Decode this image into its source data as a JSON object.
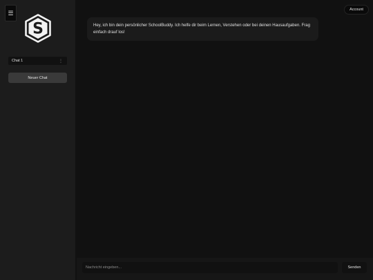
{
  "sidebar": {
    "menu_icon": "hamburger-icon",
    "menu_glyph": "☰",
    "logo_icon": "schoolbuddy-hexagon-logo",
    "logo_letter": "S",
    "chats": [
      {
        "label": "Chat 1",
        "options_glyph": "⋮"
      }
    ],
    "new_chat_label": "Neuer Chat"
  },
  "header": {
    "account_label": "Account"
  },
  "messages": [
    {
      "role": "bot",
      "text": "Hey, ich bin dein persönlicher SchoolBuddy. Ich helfe dir beim Lernen, Verstehen oder bei deinen Hausaufgaben. Frag einfach drauf los!"
    }
  ],
  "composer": {
    "placeholder": "Nachricht eingeben...",
    "value": "",
    "send_label": "Senden"
  },
  "colors": {
    "background": "#111111",
    "sidebar": "#1c1c1c",
    "bubble": "#1b1b1b",
    "button": "#3a3a3a",
    "text": "#e6e6e6"
  }
}
